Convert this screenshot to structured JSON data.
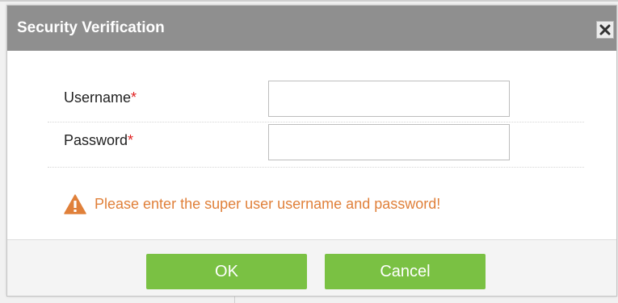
{
  "dialog": {
    "title": "Security Verification",
    "close_icon": "close-icon"
  },
  "form": {
    "username": {
      "label": "Username",
      "required_marker": "*",
      "value": "",
      "placeholder": ""
    },
    "password": {
      "label": "Password",
      "required_marker": "*",
      "value": "",
      "placeholder": ""
    }
  },
  "warning": {
    "icon": "warning-icon",
    "text": "Please enter the super user username and password!",
    "color": "#e0803a"
  },
  "buttons": {
    "ok_label": "OK",
    "cancel_label": "Cancel",
    "color": "#7ac143"
  },
  "colors": {
    "titlebar": "#8f8f8f",
    "required": "#e02020"
  }
}
